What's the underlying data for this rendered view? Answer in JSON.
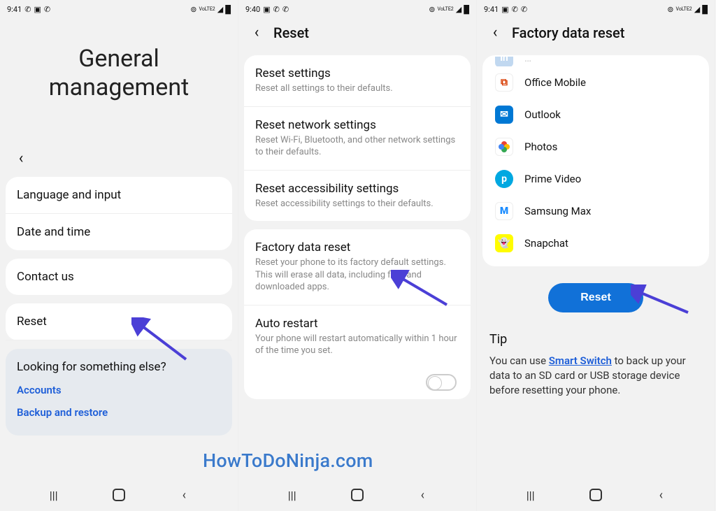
{
  "watermark": "HowToDoNinja.com",
  "screen1": {
    "time": "9:41",
    "title": "General management",
    "items": {
      "language": "Language and input",
      "datetime": "Date and time",
      "contact": "Contact us",
      "reset": "Reset"
    },
    "looking": {
      "title": "Looking for something else?",
      "accounts": "Accounts",
      "backup": "Backup and restore"
    }
  },
  "screen2": {
    "time": "9:40",
    "title": "Reset",
    "items": {
      "reset_settings": {
        "title": "Reset settings",
        "sub": "Reset all settings to their defaults."
      },
      "reset_network": {
        "title": "Reset network settings",
        "sub": "Reset Wi-Fi, Bluetooth, and other network settings to their defaults."
      },
      "reset_accessibility": {
        "title": "Reset accessibility settings",
        "sub": "Reset accessibility settings to their defaults."
      },
      "factory_reset": {
        "title": "Factory data reset",
        "sub": "Reset your phone to its factory default settings. This will erase all data, including files and downloaded apps."
      },
      "auto_restart": {
        "title": "Auto restart",
        "sub": "Your phone will restart automatically within 1 hour of the time you set."
      }
    }
  },
  "screen3": {
    "time": "9:41",
    "title": "Factory data reset",
    "apps": {
      "office": "Office Mobile",
      "outlook": "Outlook",
      "photos": "Photos",
      "prime": "Prime Video",
      "samsungmax": "Samsung Max",
      "snapchat": "Snapchat"
    },
    "reset_button": "Reset",
    "tip": {
      "title": "Tip",
      "pre": "You can use ",
      "link": "Smart Switch",
      "post": " to back up your data to an SD card or USB storage device before resetting your phone."
    }
  },
  "status_icons": {
    "lte": "VoLTE2",
    "signal": "signal-icon",
    "battery": "battery-icon"
  }
}
